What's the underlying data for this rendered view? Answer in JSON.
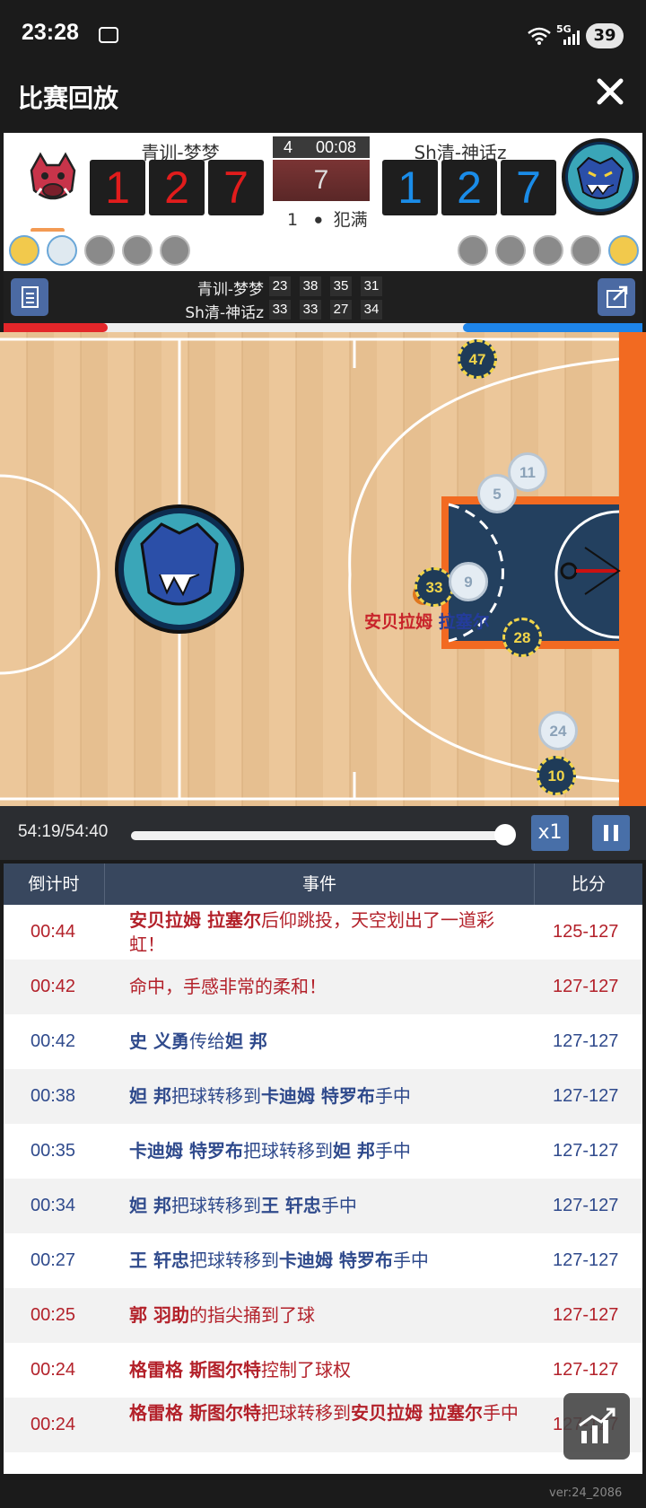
{
  "status_bar": {
    "time": "23:28",
    "network": "5G",
    "battery": "39"
  },
  "header": {
    "title": "比赛回放"
  },
  "scoreboard": {
    "home": {
      "name": "青训-梦梦",
      "score_digits": [
        "1",
        "2",
        "7"
      ],
      "color": "#e11c1c"
    },
    "away": {
      "name": "Sh清-神话z",
      "score_digits": [
        "1",
        "2",
        "7"
      ],
      "color": "#1a8ce8"
    },
    "quarter": "4",
    "clock": "00:08",
    "shot_clock": "7",
    "foul_count": "1",
    "foul_label": "犯满"
  },
  "quarter_scores": {
    "rows": [
      {
        "name": "青训-梦梦",
        "scores": [
          "23",
          "38",
          "35",
          "31"
        ]
      },
      {
        "name": "Sh清-神话z",
        "scores": [
          "33",
          "33",
          "27",
          "34"
        ]
      }
    ]
  },
  "court": {
    "players": [
      "47",
      "11",
      "5",
      "33",
      "9",
      "28",
      "24",
      "10"
    ],
    "ball_handler_name_a": "安贝拉姆",
    "ball_handler_name_b": "拉塞尔"
  },
  "playback": {
    "time": "54:19/54:40",
    "progress": 0.98,
    "speed_label": "x1"
  },
  "events": {
    "headers": {
      "countdown": "倒计时",
      "event": "事件",
      "score": "比分"
    },
    "rows": [
      {
        "time": "00:44",
        "parts": [
          {
            "text": "安贝拉姆 拉塞尔",
            "bold": true
          },
          {
            "text": "后仰跳投，天空划出了一道彩虹！",
            "bold": false
          }
        ],
        "score": "125-127",
        "team": "red"
      },
      {
        "time": "00:42",
        "parts": [
          {
            "text": "命中，手感非常的柔和！",
            "bold": false
          }
        ],
        "score": "127-127",
        "team": "red"
      },
      {
        "time": "00:42",
        "parts": [
          {
            "text": "史 义勇",
            "bold": true
          },
          {
            "text": "传给",
            "bold": false
          },
          {
            "text": "妲 邦",
            "bold": true
          }
        ],
        "score": "127-127",
        "team": "blue"
      },
      {
        "time": "00:38",
        "parts": [
          {
            "text": "妲 邦",
            "bold": true
          },
          {
            "text": "把球转移到",
            "bold": false
          },
          {
            "text": "卡迪姆 特罗布",
            "bold": true
          },
          {
            "text": "手中",
            "bold": false
          }
        ],
        "score": "127-127",
        "team": "blue"
      },
      {
        "time": "00:35",
        "parts": [
          {
            "text": "卡迪姆 特罗布",
            "bold": true
          },
          {
            "text": "把球转移到",
            "bold": false
          },
          {
            "text": "妲 邦",
            "bold": true
          },
          {
            "text": "手中",
            "bold": false
          }
        ],
        "score": "127-127",
        "team": "blue"
      },
      {
        "time": "00:34",
        "parts": [
          {
            "text": "妲 邦",
            "bold": true
          },
          {
            "text": "把球转移到",
            "bold": false
          },
          {
            "text": "王 轩忠",
            "bold": true
          },
          {
            "text": "手中",
            "bold": false
          }
        ],
        "score": "127-127",
        "team": "blue"
      },
      {
        "time": "00:27",
        "parts": [
          {
            "text": "王 轩忠",
            "bold": true
          },
          {
            "text": "把球转移到",
            "bold": false
          },
          {
            "text": "卡迪姆 特罗布",
            "bold": true
          },
          {
            "text": "手中",
            "bold": false
          }
        ],
        "score": "127-127",
        "team": "blue"
      },
      {
        "time": "00:25",
        "parts": [
          {
            "text": "郭 羽助",
            "bold": true
          },
          {
            "text": "的指尖捅到了球",
            "bold": false
          }
        ],
        "score": "127-127",
        "team": "red"
      },
      {
        "time": "00:24",
        "parts": [
          {
            "text": "格雷格 斯图尔特",
            "bold": true
          },
          {
            "text": "控制了球权",
            "bold": false
          }
        ],
        "score": "127-127",
        "team": "red"
      },
      {
        "time": "00:24",
        "parts": [
          {
            "text": "格雷格 斯图尔特",
            "bold": true
          },
          {
            "text": "把球转移到",
            "bold": false
          },
          {
            "text": "安贝拉姆 拉塞尔",
            "bold": true
          },
          {
            "text": "手中",
            "bold": false
          }
        ],
        "score": "127-127",
        "team": "red"
      }
    ]
  },
  "footer": {
    "version": "ver:24_2086"
  },
  "colors": {
    "red": "#b3212a",
    "blue": "#2f4a8c",
    "header_bg": "#38475e",
    "accent": "#486fa8"
  }
}
